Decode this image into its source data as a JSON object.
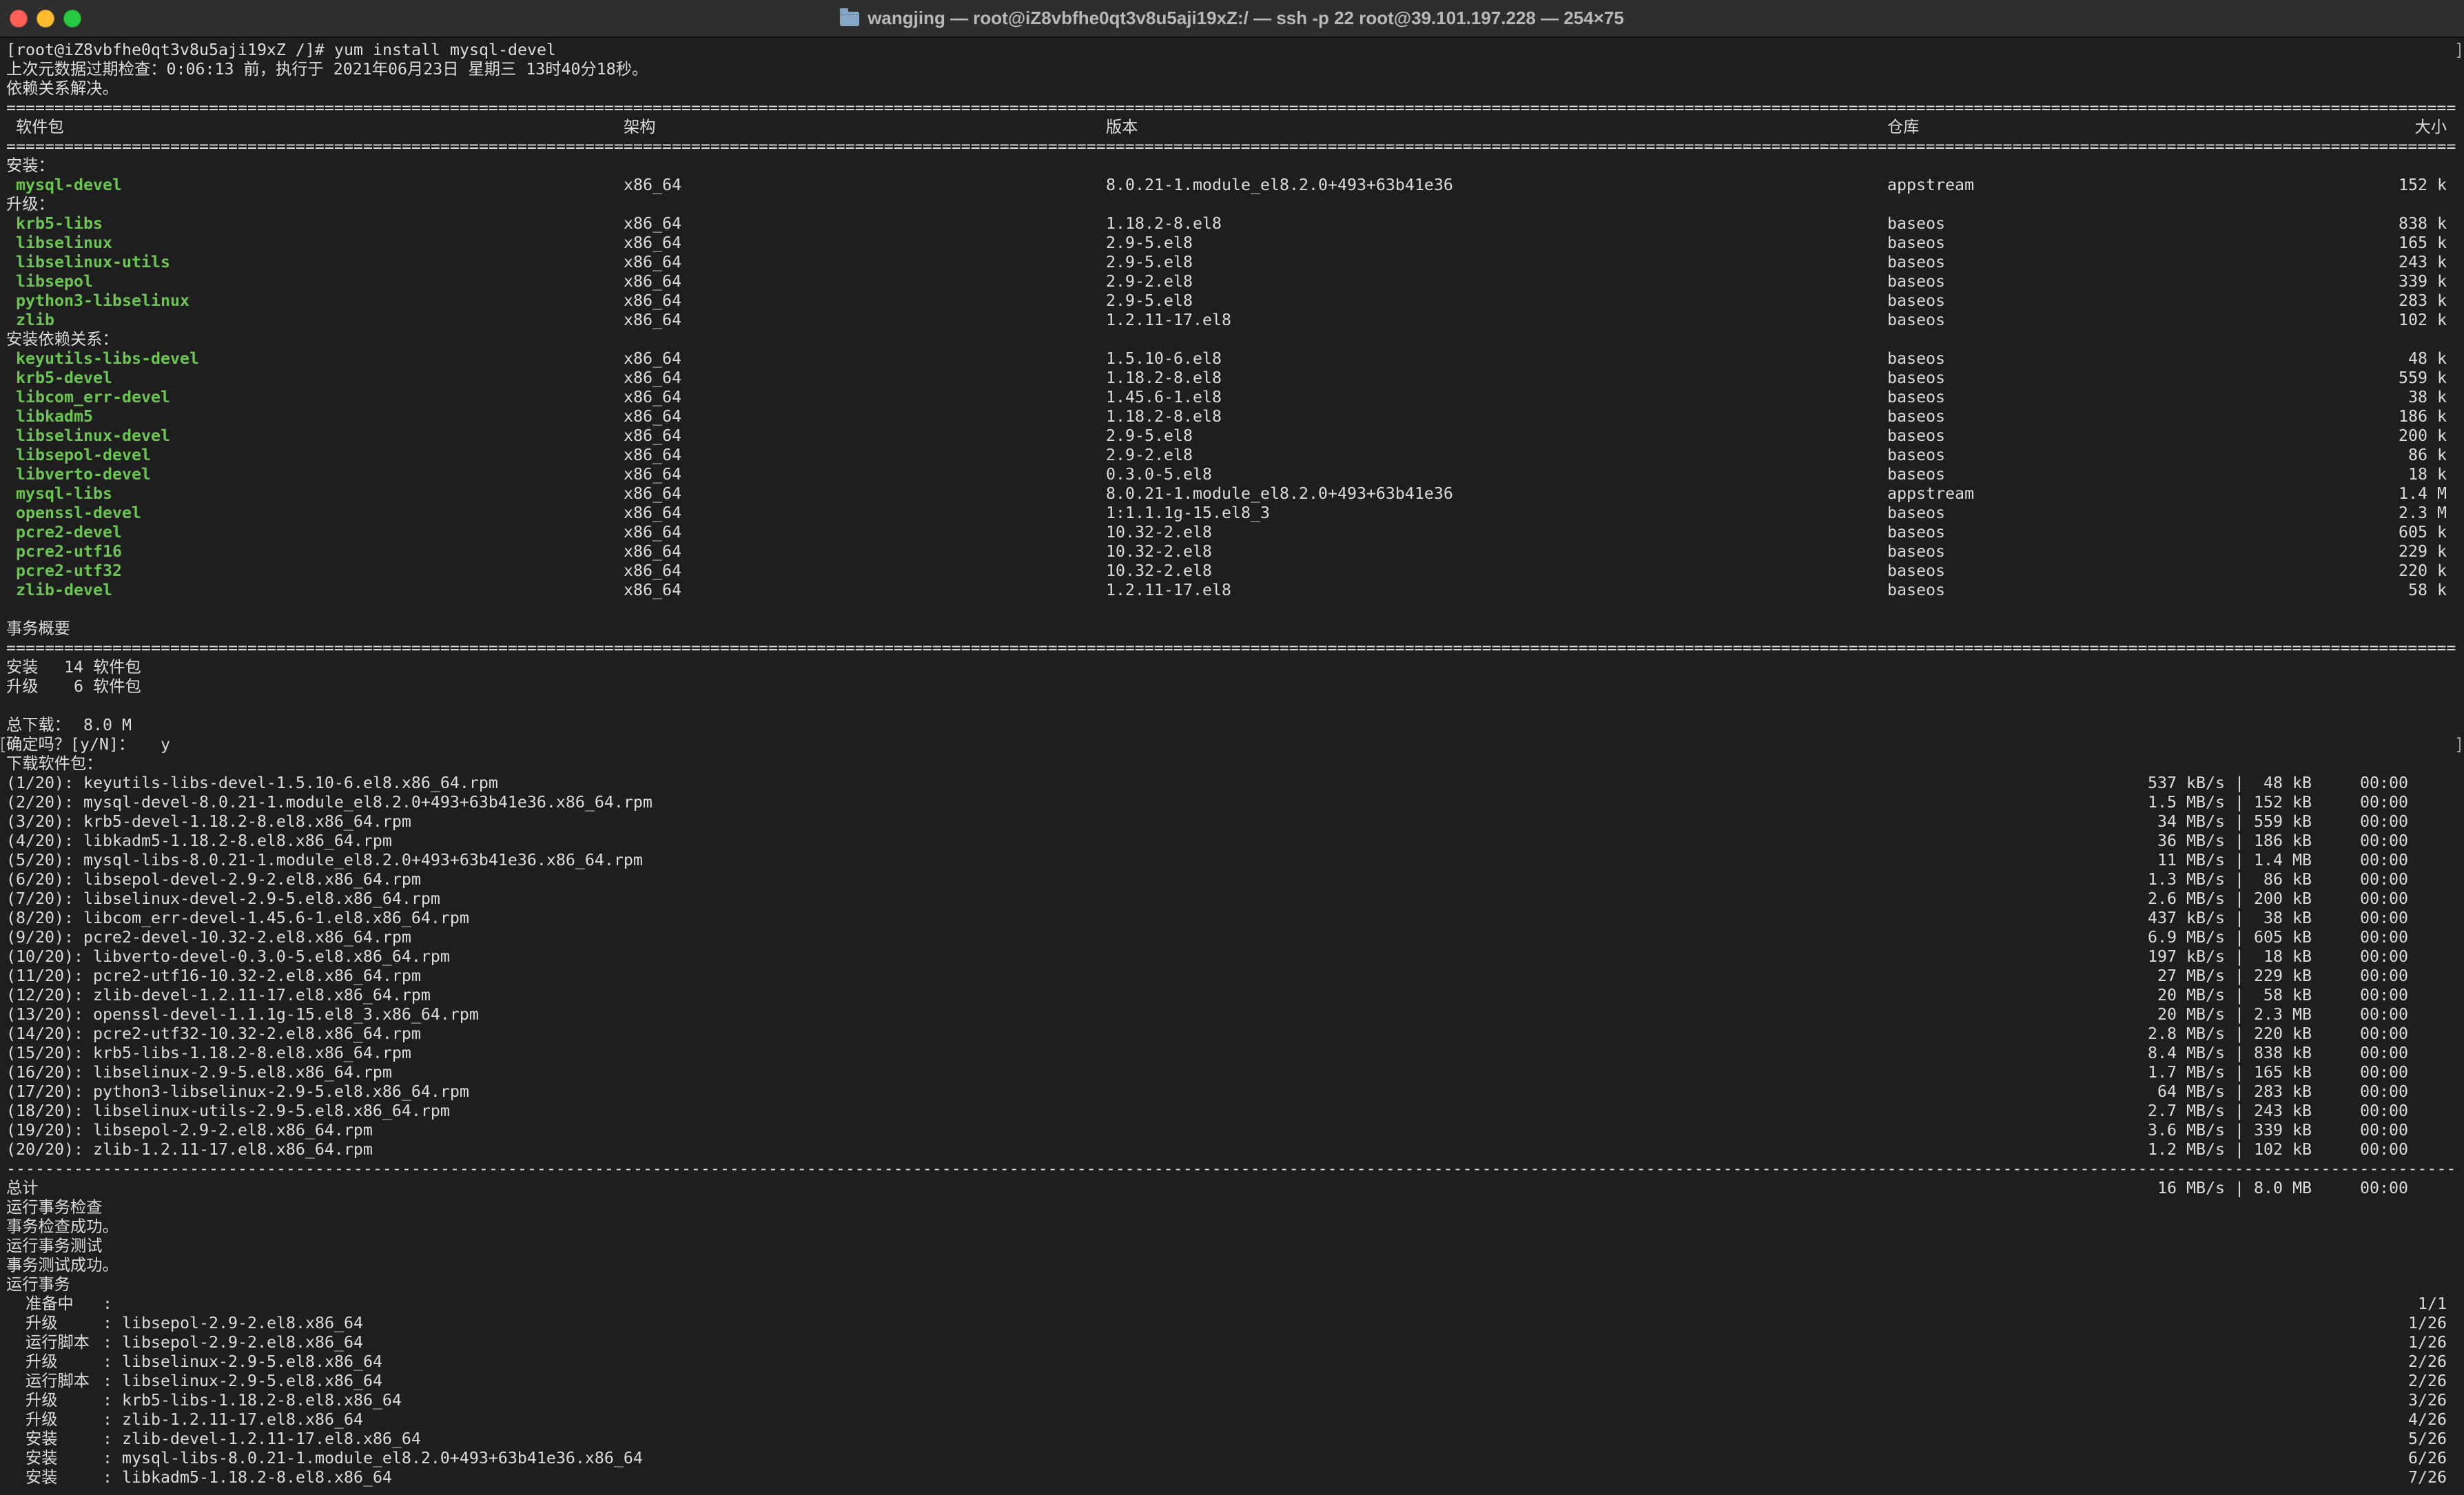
{
  "window": {
    "title": "wangjing — root@iZ8vbfhe0qt3v8u5aji19xZ:/ — ssh -p 22 root@39.101.197.228 — 254×75",
    "title_icon": "folder-icon"
  },
  "colors": {
    "background": "#1e1e1e",
    "titlebar": "#2e2e2e",
    "title_text": "#b8b8b8",
    "text": "#dcdcdc",
    "package_name": "#6cc552",
    "folder": "#86a6c8",
    "close": "#ff5f57",
    "minimize": "#febc2e",
    "zoom": "#28c840"
  },
  "rules": {
    "double": "==============================================================================================================================================================================================================================================================",
    "single": "--------------------------------------------------------------------------------------------------------------------------------------------------------------------------------------------------------------------------------------------------------------"
  },
  "session": {
    "prompt": "[root@iZ8vbfhe0qt3v8u5aji19xZ /]#",
    "command": "yum install mysql-devel",
    "metadata_check": "上次元数据过期检查：0:06:13 前，执行于 2021年06月23日 星期三 13时40分18秒。",
    "dependencies_resolved": "依赖关系解决。"
  },
  "table": {
    "headers": {
      "package": "软件包",
      "arch": "架构",
      "version": "版本",
      "repository": "仓库",
      "size": "大小"
    },
    "groups": [
      {
        "label": "安装：",
        "rows": [
          {
            "name": "mysql-devel",
            "arch": "x86_64",
            "version": "8.0.21-1.module_el8.2.0+493+63b41e36",
            "repository": "appstream",
            "size": "152 k"
          }
        ]
      },
      {
        "label": "升级：",
        "rows": [
          {
            "name": "krb5-libs",
            "arch": "x86_64",
            "version": "1.18.2-8.el8",
            "repository": "baseos",
            "size": "838 k"
          },
          {
            "name": "libselinux",
            "arch": "x86_64",
            "version": "2.9-5.el8",
            "repository": "baseos",
            "size": "165 k"
          },
          {
            "name": "libselinux-utils",
            "arch": "x86_64",
            "version": "2.9-5.el8",
            "repository": "baseos",
            "size": "243 k"
          },
          {
            "name": "libsepol",
            "arch": "x86_64",
            "version": "2.9-2.el8",
            "repository": "baseos",
            "size": "339 k"
          },
          {
            "name": "python3-libselinux",
            "arch": "x86_64",
            "version": "2.9-5.el8",
            "repository": "baseos",
            "size": "283 k"
          },
          {
            "name": "zlib",
            "arch": "x86_64",
            "version": "1.2.11-17.el8",
            "repository": "baseos",
            "size": "102 k"
          }
        ]
      },
      {
        "label": "安装依赖关系：",
        "rows": [
          {
            "name": "keyutils-libs-devel",
            "arch": "x86_64",
            "version": "1.5.10-6.el8",
            "repository": "baseos",
            "size": "48 k"
          },
          {
            "name": "krb5-devel",
            "arch": "x86_64",
            "version": "1.18.2-8.el8",
            "repository": "baseos",
            "size": "559 k"
          },
          {
            "name": "libcom_err-devel",
            "arch": "x86_64",
            "version": "1.45.6-1.el8",
            "repository": "baseos",
            "size": "38 k"
          },
          {
            "name": "libkadm5",
            "arch": "x86_64",
            "version": "1.18.2-8.el8",
            "repository": "baseos",
            "size": "186 k"
          },
          {
            "name": "libselinux-devel",
            "arch": "x86_64",
            "version": "2.9-5.el8",
            "repository": "baseos",
            "size": "200 k"
          },
          {
            "name": "libsepol-devel",
            "arch": "x86_64",
            "version": "2.9-2.el8",
            "repository": "baseos",
            "size": "86 k"
          },
          {
            "name": "libverto-devel",
            "arch": "x86_64",
            "version": "0.3.0-5.el8",
            "repository": "baseos",
            "size": "18 k"
          },
          {
            "name": "mysql-libs",
            "arch": "x86_64",
            "version": "8.0.21-1.module_el8.2.0+493+63b41e36",
            "repository": "appstream",
            "size": "1.4 M"
          },
          {
            "name": "openssl-devel",
            "arch": "x86_64",
            "version": "1:1.1.1g-15.el8_3",
            "repository": "baseos",
            "size": "2.3 M"
          },
          {
            "name": "pcre2-devel",
            "arch": "x86_64",
            "version": "10.32-2.el8",
            "repository": "baseos",
            "size": "605 k"
          },
          {
            "name": "pcre2-utf16",
            "arch": "x86_64",
            "version": "10.32-2.el8",
            "repository": "baseos",
            "size": "229 k"
          },
          {
            "name": "pcre2-utf32",
            "arch": "x86_64",
            "version": "10.32-2.el8",
            "repository": "baseos",
            "size": "220 k"
          },
          {
            "name": "zlib-devel",
            "arch": "x86_64",
            "version": "1.2.11-17.el8",
            "repository": "baseos",
            "size": "58 k"
          }
        ]
      }
    ]
  },
  "summary": {
    "title": "事务概要",
    "install": {
      "label": "安装",
      "count": "14",
      "unit": "软件包"
    },
    "upgrade": {
      "label": "升级",
      "count": "6",
      "unit": "软件包"
    },
    "total_download": {
      "label": "总下载：",
      "value": "8.0 M"
    },
    "confirm": {
      "prompt": "确定吗？[y/N]：",
      "answer": "y"
    }
  },
  "download": {
    "title": "下载软件包：",
    "column_separator": "|",
    "files": [
      {
        "label": "(1/20): keyutils-libs-devel-1.5.10-6.el8.x86_64.rpm",
        "speed": "537 kB/s",
        "size": "48 kB",
        "time": "00:00"
      },
      {
        "label": "(2/20): mysql-devel-8.0.21-1.module_el8.2.0+493+63b41e36.x86_64.rpm",
        "speed": "1.5 MB/s",
        "size": "152 kB",
        "time": "00:00"
      },
      {
        "label": "(3/20): krb5-devel-1.18.2-8.el8.x86_64.rpm",
        "speed": "34 MB/s",
        "size": "559 kB",
        "time": "00:00"
      },
      {
        "label": "(4/20): libkadm5-1.18.2-8.el8.x86_64.rpm",
        "speed": "36 MB/s",
        "size": "186 kB",
        "time": "00:00"
      },
      {
        "label": "(5/20): mysql-libs-8.0.21-1.module_el8.2.0+493+63b41e36.x86_64.rpm",
        "speed": "11 MB/s",
        "size": "1.4 MB",
        "time": "00:00"
      },
      {
        "label": "(6/20): libsepol-devel-2.9-2.el8.x86_64.rpm",
        "speed": "1.3 MB/s",
        "size": "86 kB",
        "time": "00:00"
      },
      {
        "label": "(7/20): libselinux-devel-2.9-5.el8.x86_64.rpm",
        "speed": "2.6 MB/s",
        "size": "200 kB",
        "time": "00:00"
      },
      {
        "label": "(8/20): libcom_err-devel-1.45.6-1.el8.x86_64.rpm",
        "speed": "437 kB/s",
        "size": "38 kB",
        "time": "00:00"
      },
      {
        "label": "(9/20): pcre2-devel-10.32-2.el8.x86_64.rpm",
        "speed": "6.9 MB/s",
        "size": "605 kB",
        "time": "00:00"
      },
      {
        "label": "(10/20): libverto-devel-0.3.0-5.el8.x86_64.rpm",
        "speed": "197 kB/s",
        "size": "18 kB",
        "time": "00:00"
      },
      {
        "label": "(11/20): pcre2-utf16-10.32-2.el8.x86_64.rpm",
        "speed": "27 MB/s",
        "size": "229 kB",
        "time": "00:00"
      },
      {
        "label": "(12/20): zlib-devel-1.2.11-17.el8.x86_64.rpm",
        "speed": "20 MB/s",
        "size": "58 kB",
        "time": "00:00"
      },
      {
        "label": "(13/20): openssl-devel-1.1.1g-15.el8_3.x86_64.rpm",
        "speed": "20 MB/s",
        "size": "2.3 MB",
        "time": "00:00"
      },
      {
        "label": "(14/20): pcre2-utf32-10.32-2.el8.x86_64.rpm",
        "speed": "2.8 MB/s",
        "size": "220 kB",
        "time": "00:00"
      },
      {
        "label": "(15/20): krb5-libs-1.18.2-8.el8.x86_64.rpm",
        "speed": "8.4 MB/s",
        "size": "838 kB",
        "time": "00:00"
      },
      {
        "label": "(16/20): libselinux-2.9-5.el8.x86_64.rpm",
        "speed": "1.7 MB/s",
        "size": "165 kB",
        "time": "00:00"
      },
      {
        "label": "(17/20): python3-libselinux-2.9-5.el8.x86_64.rpm",
        "speed": "64 MB/s",
        "size": "283 kB",
        "time": "00:00"
      },
      {
        "label": "(18/20): libselinux-utils-2.9-5.el8.x86_64.rpm",
        "speed": "2.7 MB/s",
        "size": "243 kB",
        "time": "00:00"
      },
      {
        "label": "(19/20): libsepol-2.9-2.el8.x86_64.rpm",
        "speed": "3.6 MB/s",
        "size": "339 kB",
        "time": "00:00"
      },
      {
        "label": "(20/20): zlib-1.2.11-17.el8.x86_64.rpm",
        "speed": "1.2 MB/s",
        "size": "102 kB",
        "time": "00:00"
      }
    ],
    "total": {
      "label": "总计",
      "speed": "16 MB/s",
      "size": "8.0 MB",
      "time": "00:00"
    }
  },
  "transaction": {
    "check_running": "运行事务检查",
    "check_ok": "事务检查成功。",
    "test_running": "运行事务测试",
    "test_ok": "事务测试成功。",
    "running": "运行事务",
    "step_separator": ":",
    "steps": [
      {
        "action": "准备中",
        "package": "",
        "progress": "1/1"
      },
      {
        "action": "升级",
        "package": "libsepol-2.9-2.el8.x86_64",
        "progress": "1/26"
      },
      {
        "action": "运行脚本",
        "package": "libsepol-2.9-2.el8.x86_64",
        "progress": "1/26"
      },
      {
        "action": "升级",
        "package": "libselinux-2.9-5.el8.x86_64",
        "progress": "2/26"
      },
      {
        "action": "运行脚本",
        "package": "libselinux-2.9-5.el8.x86_64",
        "progress": "2/26"
      },
      {
        "action": "升级",
        "package": "krb5-libs-1.18.2-8.el8.x86_64",
        "progress": "3/26"
      },
      {
        "action": "升级",
        "package": "zlib-1.2.11-17.el8.x86_64",
        "progress": "4/26"
      },
      {
        "action": "安装",
        "package": "zlib-devel-1.2.11-17.el8.x86_64",
        "progress": "5/26"
      },
      {
        "action": "安装",
        "package": "mysql-libs-8.0.21-1.module_el8.2.0+493+63b41e36.x86_64",
        "progress": "6/26"
      },
      {
        "action": "安装",
        "package": "libkadm5-1.18.2-8.el8.x86_64",
        "progress": "7/26"
      }
    ]
  }
}
